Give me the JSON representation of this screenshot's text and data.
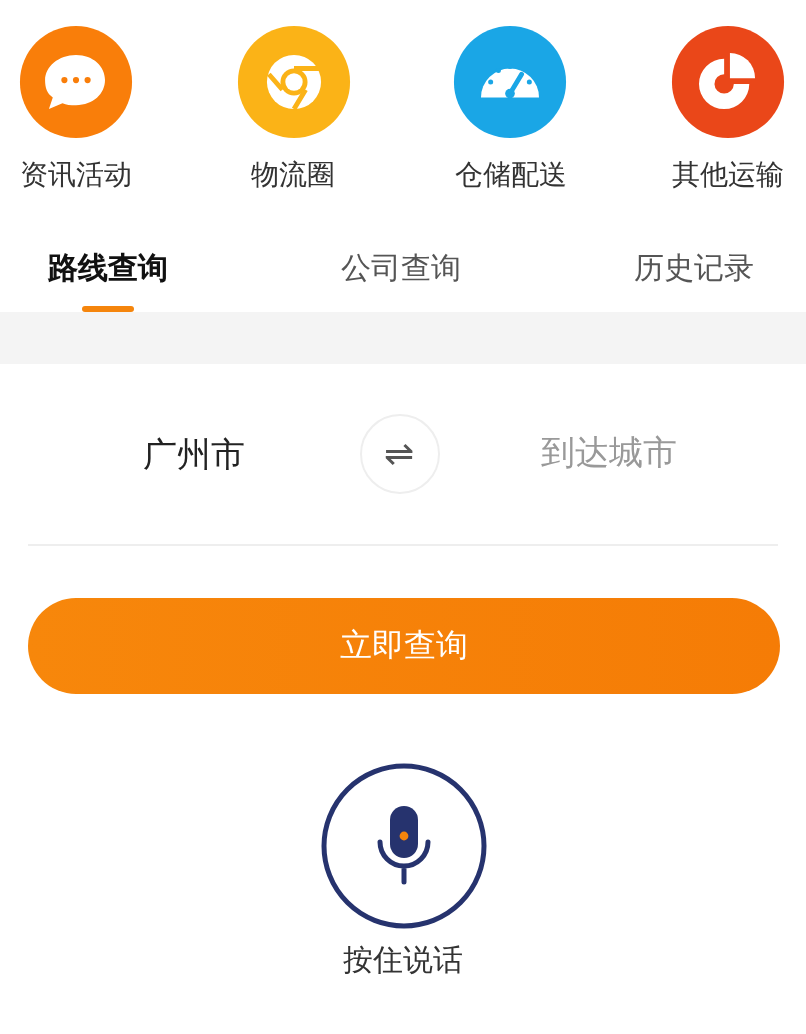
{
  "shortcuts": [
    {
      "label": "资讯活动",
      "kind": "chat",
      "color": "#f97e0a"
    },
    {
      "label": "物流圈",
      "kind": "ring",
      "color": "#fbb317"
    },
    {
      "label": "仓储配送",
      "kind": "gauge",
      "color": "#1aa6e6"
    },
    {
      "label": "其他运输",
      "kind": "pie",
      "color": "#ea4719"
    }
  ],
  "tabs": [
    {
      "label": "路线查询",
      "selected": true
    },
    {
      "label": "公司查询",
      "selected": false
    },
    {
      "label": "历史记录",
      "selected": false
    }
  ],
  "route": {
    "from": "广州市",
    "to_placeholder": "到达城市",
    "swap": "⇌"
  },
  "query_button": "立即查询",
  "voice": {
    "label": "按住说话"
  }
}
